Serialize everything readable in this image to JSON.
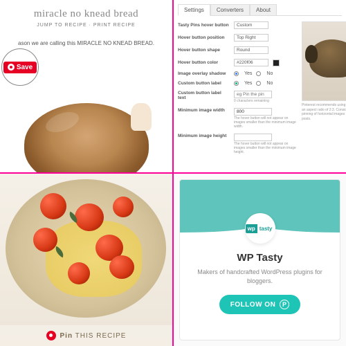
{
  "q1": {
    "title": "miracle no knead bread",
    "subtitle": "JUMP TO RECIPE · PRINT RECIPE",
    "description": "ason we are calling this MIRACLE NO KNEAD BREAD.",
    "save_label": "Save"
  },
  "q2": {
    "tabs": [
      "Settings",
      "Converters",
      "About"
    ],
    "rows": {
      "hover_button": {
        "label": "Tasty Pins hover button",
        "value": "Custom"
      },
      "position": {
        "label": "Hover button position",
        "value": "Top Right"
      },
      "shape": {
        "label": "Hover button shape",
        "value": "Round"
      },
      "color": {
        "label": "Hover button color",
        "value": "#220f06"
      },
      "shadow": {
        "label": "Image overlay shadow",
        "yes": "Yes",
        "no": "No"
      },
      "custom_label": {
        "label": "Custom button label",
        "yes": "Yes",
        "no": "No"
      },
      "label_text": {
        "label": "Custom button label text",
        "placeholder": "eg Pin the pin",
        "help": "0 characters remaining"
      },
      "min_width": {
        "label": "Minimum image width",
        "value": "800",
        "help": "The hover button will not appear on images smaller than the minimum image width."
      },
      "min_height": {
        "label": "Minimum image height",
        "value": "",
        "help": "The hover button will not appear on images smaller than the minimum image height."
      }
    },
    "preview_help": "Pinterest recommends using images with an aspect ratio of 2:3. Consider disabling pinning of horizontal images in your posts."
  },
  "q3": {
    "pin_prefix": "Pin",
    "pin_text": " THIS RECIPE"
  },
  "q4": {
    "logo_wp": "wp",
    "logo_tasty": "tasty",
    "title": "WP Tasty",
    "description": "Makers of handcrafted WordPress plugins for bloggers.",
    "follow_label": "FOLLOW ON",
    "close": "✕"
  }
}
